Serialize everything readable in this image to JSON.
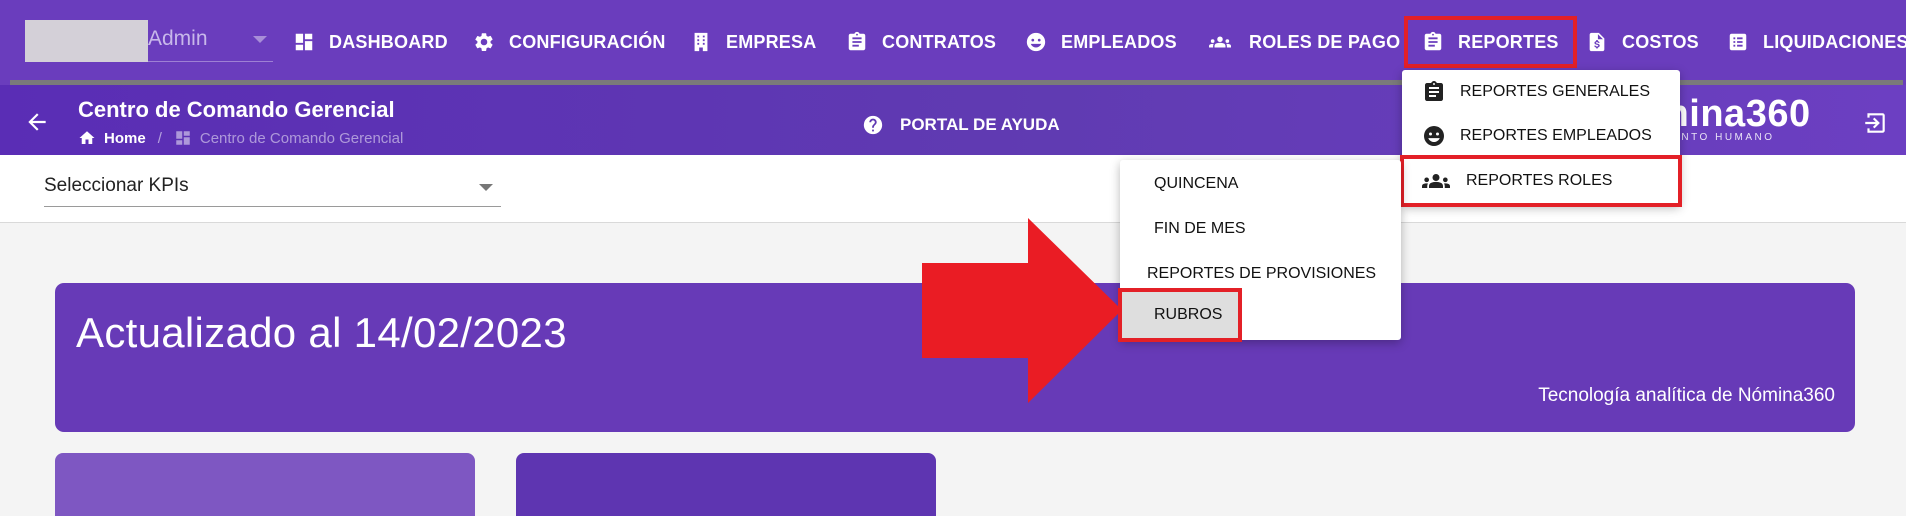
{
  "user": {
    "name": "Admin"
  },
  "topnav": {
    "items": [
      {
        "label": "DASHBOARD",
        "icon": "dashboard-icon"
      },
      {
        "label": "CONFIGURACIÓN",
        "icon": "gear-icon"
      },
      {
        "label": "EMPRESA",
        "icon": "building-icon"
      },
      {
        "label": "CONTRATOS",
        "icon": "clipboard-icon"
      },
      {
        "label": "EMPLEADOS",
        "icon": "face-icon"
      },
      {
        "label": "ROLES DE PAGO",
        "icon": "group-icon"
      },
      {
        "label": "REPORTES",
        "icon": "clipboard-icon"
      },
      {
        "label": "COSTOS",
        "icon": "invoice-icon"
      },
      {
        "label": "LIQUIDACIONES",
        "icon": "list-icon"
      }
    ]
  },
  "header": {
    "title": "Centro de Comando Gerencial",
    "breadcrumb": {
      "home": "Home",
      "current": "Centro de Comando Gerencial"
    },
    "help_label": "PORTAL DE AYUDA",
    "brand_name": "mina360",
    "brand_tagline": "ALENTO HUMANO"
  },
  "filter": {
    "kpi_label": "Seleccionar KPIs"
  },
  "banner": {
    "updated_text": "Actualizado al 14/02/2023",
    "tech_text": "Tecnología analítica de Nómina360"
  },
  "reportes_menu": {
    "items": [
      {
        "label": "REPORTES GENERALES",
        "icon": "clipboard-icon"
      },
      {
        "label": "REPORTES EMPLEADOS",
        "icon": "face-icon"
      },
      {
        "label": "REPORTES ROLES",
        "icon": "group-icon"
      }
    ]
  },
  "roles_submenu": {
    "items": [
      {
        "label": "QUINCENA"
      },
      {
        "label": "FIN DE MES"
      },
      {
        "label": "REPORTES DE PROVISIONES"
      },
      {
        "label": "RUBROS"
      }
    ]
  },
  "colors": {
    "nav_bg": "#6a3dbd",
    "header_bg": "#5a2db5",
    "banner_bg": "#673ab7",
    "highlight_red": "#e32027",
    "annotation_red": "#ea1c24"
  }
}
